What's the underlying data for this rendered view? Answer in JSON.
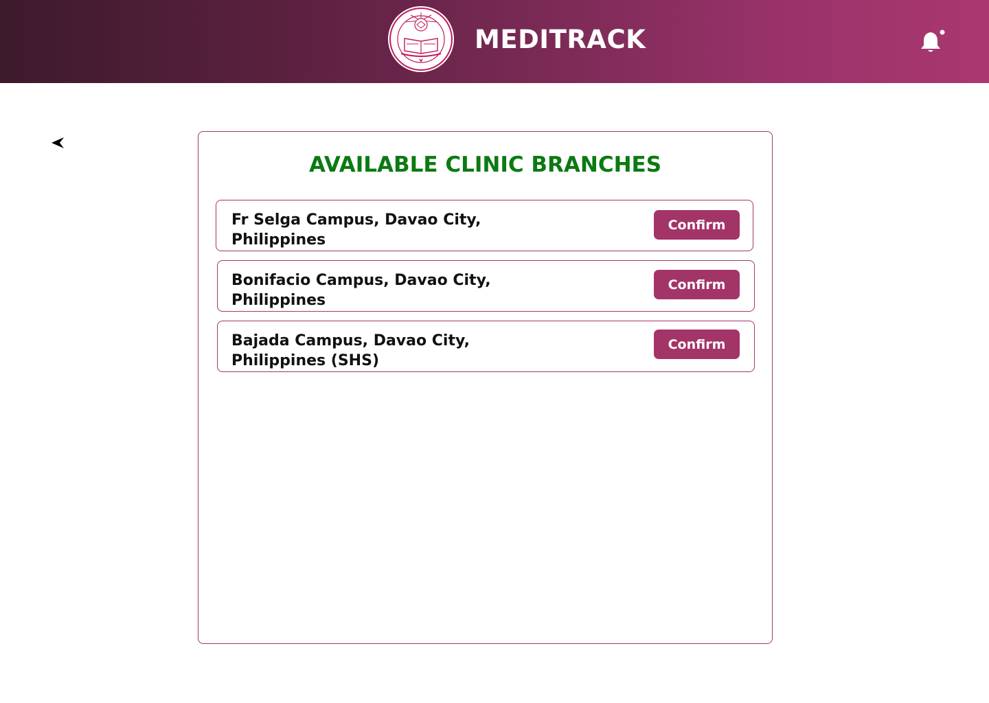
{
  "app": {
    "title": "MEDITRACK",
    "brand_color": "#a33468",
    "header_gradient": [
      "#3d1a2c",
      "#a9386f"
    ]
  },
  "header": {
    "logo_icon": "university-seal-logo",
    "notification_icon": "bell-icon"
  },
  "nav": {
    "back_icon": "back-arrow-icon"
  },
  "main": {
    "title": "AVAILABLE CLINIC BRANCHES",
    "title_color": "#0b7a12",
    "branches": [
      {
        "label": "Fr Selga Campus, Davao City,\nPhilippines",
        "button": "Confirm"
      },
      {
        "label": "Bonifacio Campus, Davao City,\nPhilippines",
        "button": "Confirm"
      },
      {
        "label": "Bajada Campus, Davao City,\nPhilippines   (SHS)",
        "button": "Confirm"
      }
    ]
  }
}
